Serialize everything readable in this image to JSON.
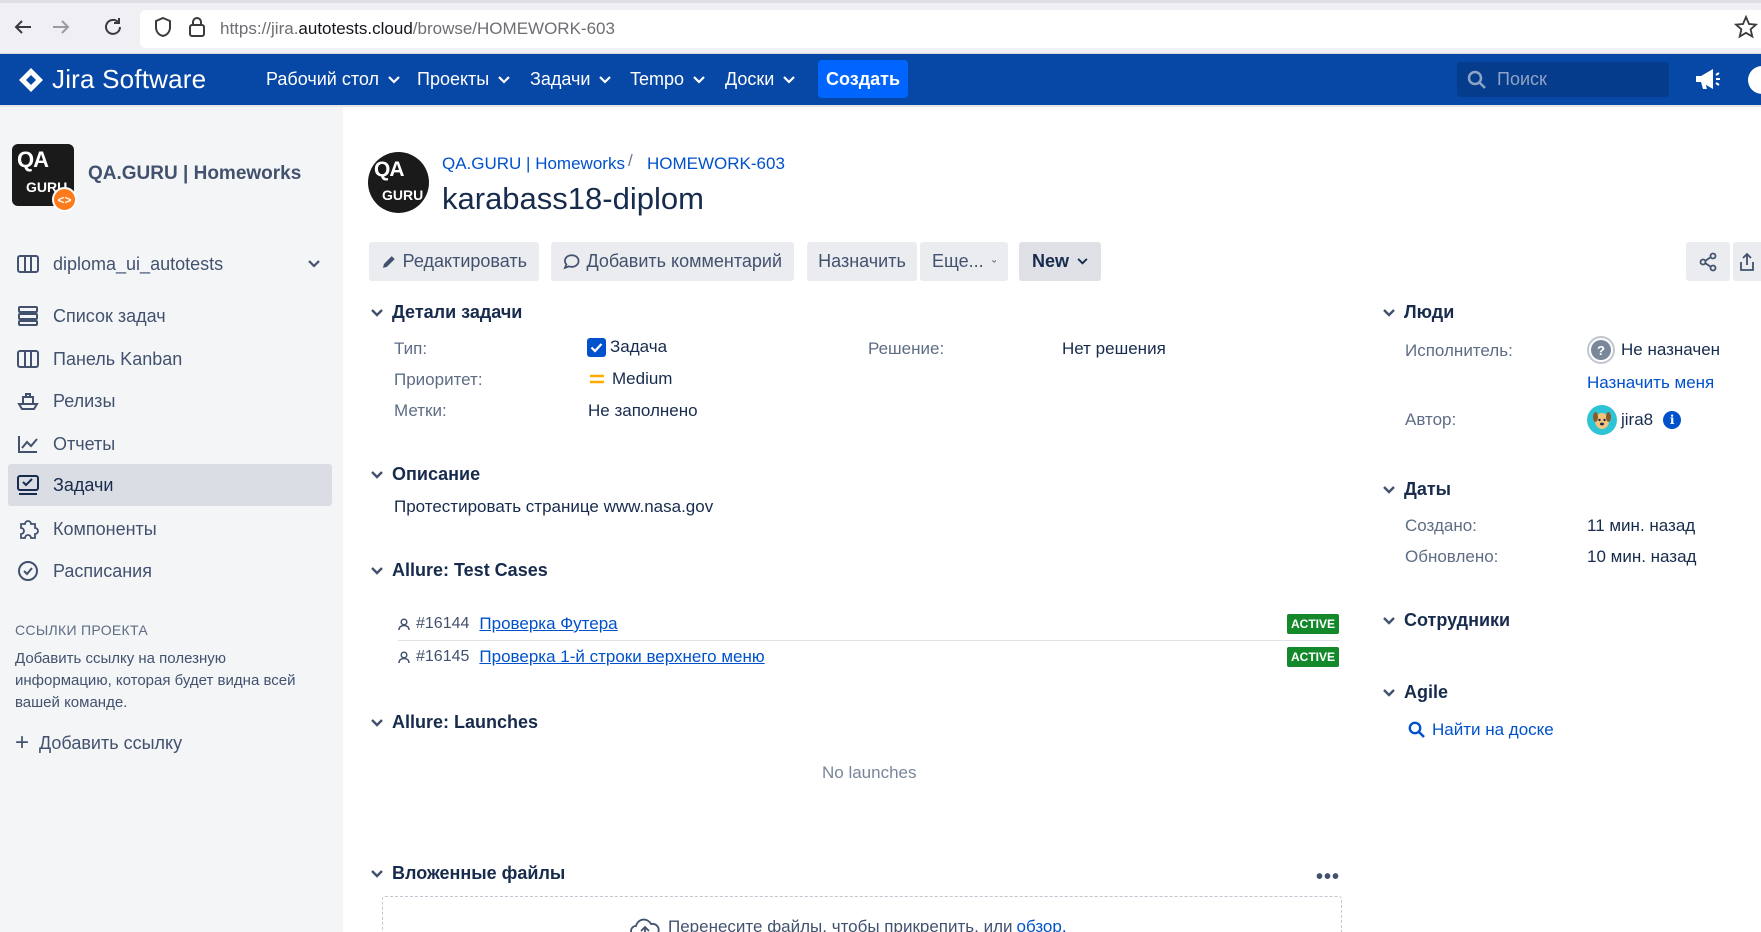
{
  "browser": {
    "url_prefix": "https://jira.",
    "url_domain": "autotests.cloud",
    "url_path": "/browse/HOMEWORK-603"
  },
  "nav": {
    "logo": "Jira Software",
    "menu": [
      "Рабочий стол",
      "Проекты",
      "Задачи",
      "Tempo",
      "Доски"
    ],
    "create": "Создать",
    "search_placeholder": "Поиск"
  },
  "sidebar": {
    "project_name": "QA.GURU | Homeworks",
    "avatar_top": "QA",
    "avatar_bottom": "GURU",
    "board": "diploma_ui_autotests",
    "items": [
      {
        "label": "Список задач",
        "icon": "backlog-icon"
      },
      {
        "label": "Панель Kanban",
        "icon": "board-icon"
      },
      {
        "label": "Релизы",
        "icon": "ship-icon"
      },
      {
        "label": "Отчеты",
        "icon": "reports-icon"
      },
      {
        "label": "Задачи",
        "icon": "issues-icon"
      },
      {
        "label": "Компоненты",
        "icon": "components-icon"
      },
      {
        "label": "Расписания",
        "icon": "schedule-icon"
      }
    ],
    "active_index": 4,
    "links_title": "ССЫЛКИ ПРОЕКТА",
    "links_desc": "Добавить ссылку на полезную информацию, которая будет видна всей вашей команде.",
    "add_link": "Добавить ссылку"
  },
  "issue": {
    "breadcrumb_project": "QA.GURU | Homeworks",
    "breadcrumb_sep": "/",
    "breadcrumb_key": "HOMEWORK-603",
    "title": "karabass18-diplom"
  },
  "toolbar": {
    "edit": "Редактировать",
    "comment": "Добавить комментарий",
    "assign": "Назначить",
    "more": "Еще...",
    "status": "New"
  },
  "details": {
    "title": "Детали задачи",
    "type_label": "Тип:",
    "type_value": "Задача",
    "priority_label": "Приоритет:",
    "priority_value": "Medium",
    "labels_label": "Метки:",
    "labels_value": "Не заполнено",
    "resolution_label": "Решение:",
    "resolution_value": "Нет решения"
  },
  "description": {
    "title": "Описание",
    "text": "Протестировать странице www.nasa.gov"
  },
  "allure_cases": {
    "title": "Allure: Test Cases",
    "rows": [
      {
        "id": "#16144",
        "name": "Проверка Футера",
        "status": "ACTIVE"
      },
      {
        "id": "#16145",
        "name": "Проверка 1-й строки верхнего меню",
        "status": "ACTIVE"
      }
    ]
  },
  "allure_launches": {
    "title": "Allure: Launches",
    "empty": "No launches"
  },
  "attachments": {
    "title": "Вложенные файлы",
    "more": "•••",
    "drop_text": "Перенесите файлы, чтобы прикрепить, или ",
    "browse": "обзор."
  },
  "people": {
    "title": "Люди",
    "assignee_label": "Исполнитель:",
    "assignee_value": "Не назначен",
    "assign_me": "Назначить меня",
    "reporter_label": "Автор:",
    "reporter_value": "jira8"
  },
  "dates": {
    "title": "Даты",
    "created_label": "Создано:",
    "created_value": "11 мин. назад",
    "updated_label": "Обновлено:",
    "updated_value": "10 мин. назад"
  },
  "employees": {
    "title": "Сотрудники"
  },
  "agile": {
    "title": "Agile",
    "find_on_board": "Найти на доске"
  },
  "colors": {
    "nav": "#0747a6",
    "create": "#0065ff",
    "link": "#0052cc",
    "active_badge": "#14892c",
    "priority": "#ffab00"
  }
}
